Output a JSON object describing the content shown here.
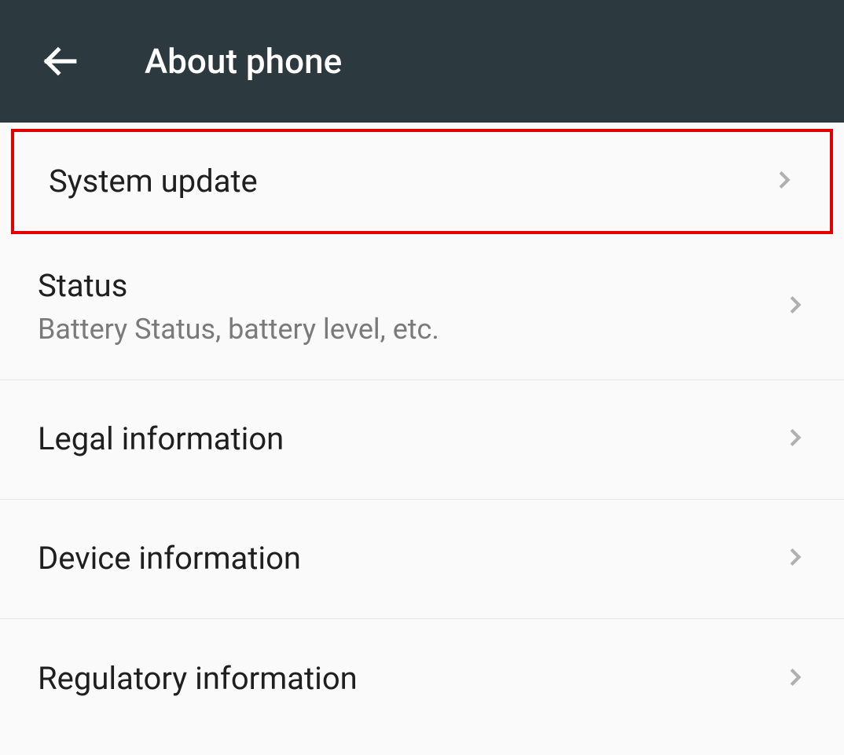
{
  "header": {
    "title": "About phone"
  },
  "items": [
    {
      "title": "System update",
      "subtitle": "",
      "highlighted": true
    },
    {
      "title": "Status",
      "subtitle": "Battery Status, battery level, etc.",
      "highlighted": false
    },
    {
      "title": "Legal information",
      "subtitle": "",
      "highlighted": false
    },
    {
      "title": "Device information",
      "subtitle": "",
      "highlighted": false
    },
    {
      "title": "Regulatory information",
      "subtitle": "",
      "highlighted": false
    }
  ]
}
